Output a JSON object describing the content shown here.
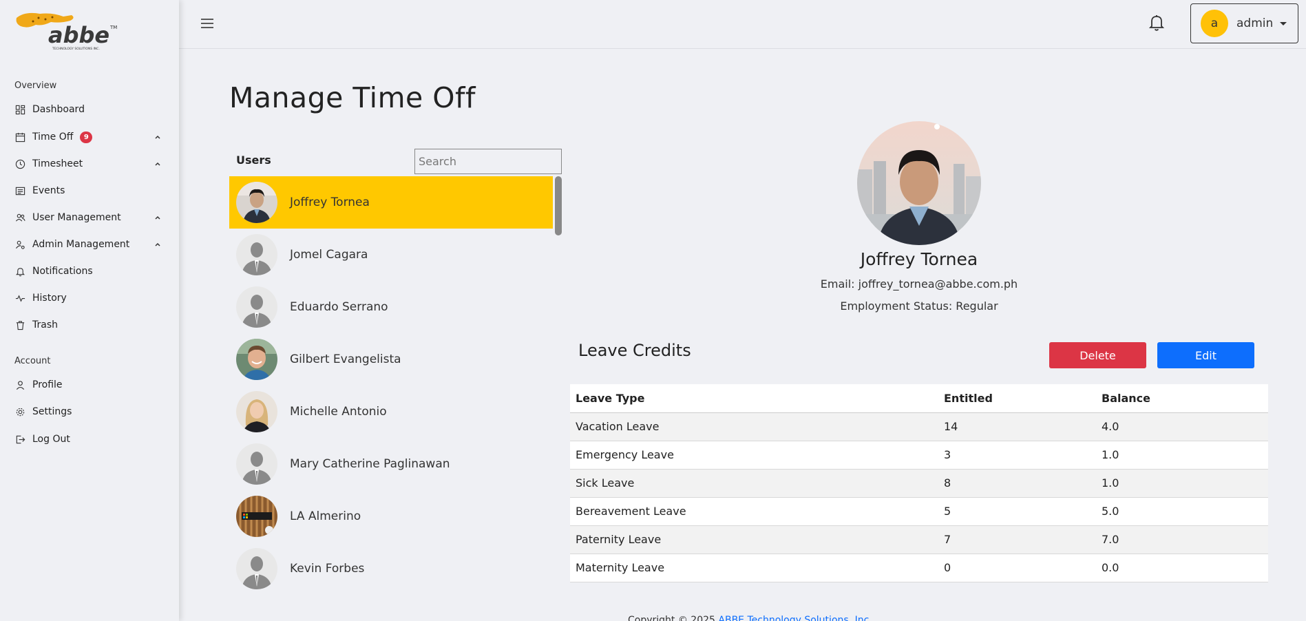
{
  "brand": {
    "logo_text": "abbe",
    "logo_tagline": "TECHNOLOGY SOLUTIONS INC.",
    "accent": "#ffc800"
  },
  "sidebar": {
    "overview_label": "Overview",
    "account_label": "Account",
    "overview_items": [
      {
        "label": "Dashboard",
        "icon": "dashboard-icon"
      },
      {
        "label": "Time Off",
        "icon": "calendar-icon",
        "badge": "9",
        "expandable": true
      },
      {
        "label": "Timesheet",
        "icon": "clock-icon",
        "expandable": true
      },
      {
        "label": "Events",
        "icon": "events-icon"
      },
      {
        "label": "User Management",
        "icon": "users-icon",
        "expandable": true
      },
      {
        "label": "Admin Management",
        "icon": "admin-icon",
        "expandable": true
      },
      {
        "label": "Notifications",
        "icon": "bell-icon"
      },
      {
        "label": "History",
        "icon": "activity-icon"
      },
      {
        "label": "Trash",
        "icon": "trash-icon"
      }
    ],
    "account_items": [
      {
        "label": "Profile",
        "icon": "user-icon"
      },
      {
        "label": "Settings",
        "icon": "gear-icon"
      },
      {
        "label": "Log Out",
        "icon": "logout-icon"
      }
    ]
  },
  "topbar": {
    "user_initial": "a",
    "user_name": "admin"
  },
  "main": {
    "title": "Manage Time Off",
    "users_label": "Users",
    "search_placeholder": "Search",
    "users": [
      {
        "name": "Joffrey Tornea",
        "active": true,
        "avatar": "photo"
      },
      {
        "name": "Jomel Cagara",
        "avatar": "placeholder"
      },
      {
        "name": "Eduardo Serrano",
        "avatar": "placeholder"
      },
      {
        "name": "Gilbert Evangelista",
        "avatar": "photo"
      },
      {
        "name": "Michelle Antonio",
        "avatar": "photo"
      },
      {
        "name": "Mary Catherine Paglinawan",
        "avatar": "placeholder"
      },
      {
        "name": "LA Almerino",
        "avatar": "photo"
      },
      {
        "name": "Kevin Forbes",
        "avatar": "placeholder"
      }
    ]
  },
  "profile": {
    "name": "Joffrey Tornea",
    "email": "Email: joffrey_tornea@abbe.com.ph",
    "status": "Employment Status: Regular"
  },
  "leave": {
    "title": "Leave Credits",
    "delete_label": "Delete",
    "edit_label": "Edit",
    "headers": [
      "Leave Type",
      "Entitled",
      "Balance"
    ],
    "rows": [
      [
        "Vacation Leave",
        "14",
        "4.0"
      ],
      [
        "Emergency Leave",
        "3",
        "1.0"
      ],
      [
        "Sick Leave",
        "8",
        "1.0"
      ],
      [
        "Bereavement Leave",
        "5",
        "5.0"
      ],
      [
        "Paternity Leave",
        "7",
        "7.0"
      ],
      [
        "Maternity Leave",
        "0",
        "0.0"
      ]
    ]
  },
  "footer": {
    "text": "Copyright © 2025 ",
    "link": "ABBE Technology Solutions, Inc."
  }
}
